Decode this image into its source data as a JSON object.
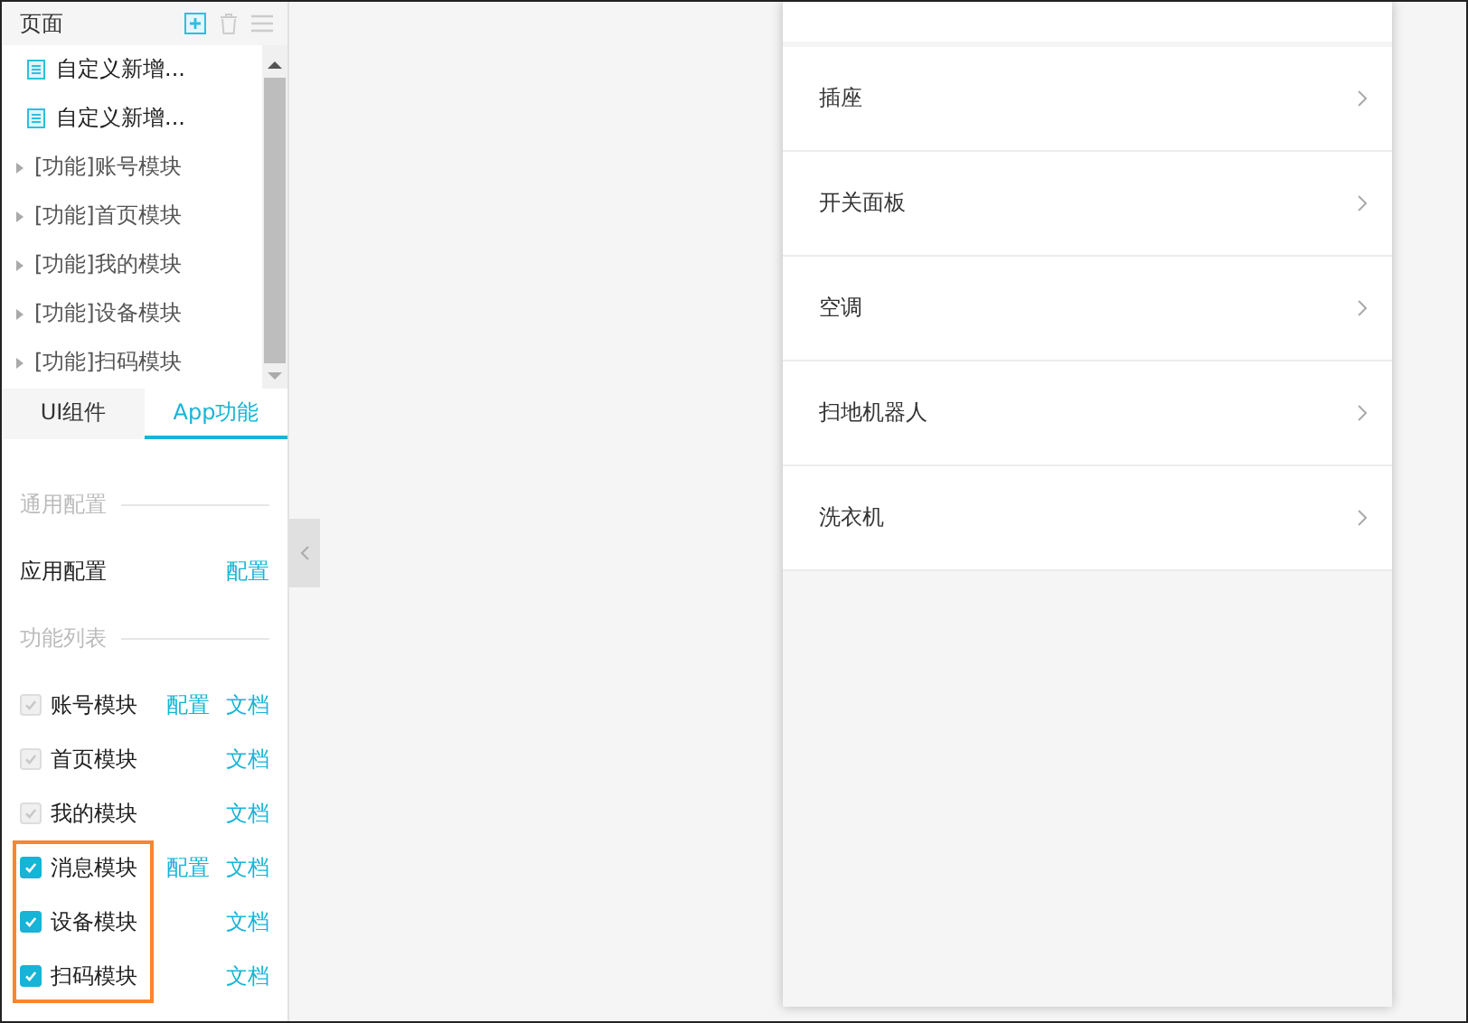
{
  "pages_panel": {
    "title": "页面",
    "items": [
      {
        "kind": "page",
        "label": "自定义新增..."
      },
      {
        "kind": "page",
        "label": "自定义新增..."
      },
      {
        "kind": "group",
        "label": "[功能]账号模块"
      },
      {
        "kind": "group",
        "label": "[功能]首页模块"
      },
      {
        "kind": "group",
        "label": "[功能]我的模块"
      },
      {
        "kind": "group",
        "label": "[功能]设备模块"
      },
      {
        "kind": "group",
        "label": "[功能]扫码模块"
      }
    ]
  },
  "tabs": [
    {
      "label": "UI组件",
      "selected": false
    },
    {
      "label": "App功能",
      "selected": true
    }
  ],
  "general": {
    "title": "通用配置",
    "rows": [
      {
        "label": "应用配置",
        "links": [
          "配置"
        ]
      }
    ]
  },
  "features": {
    "title": "功能列表",
    "modules": [
      {
        "label": "账号模块",
        "checked": true,
        "disabled": true,
        "highlighted": false,
        "links": [
          "配置",
          "文档"
        ]
      },
      {
        "label": "首页模块",
        "checked": true,
        "disabled": true,
        "highlighted": false,
        "links": [
          "文档"
        ]
      },
      {
        "label": "我的模块",
        "checked": true,
        "disabled": true,
        "highlighted": false,
        "links": [
          "文档"
        ]
      },
      {
        "label": "消息模块",
        "checked": true,
        "disabled": false,
        "highlighted": true,
        "links": [
          "配置",
          "文档"
        ]
      },
      {
        "label": "设备模块",
        "checked": true,
        "disabled": false,
        "highlighted": true,
        "links": [
          "文档"
        ]
      },
      {
        "label": "扫码模块",
        "checked": true,
        "disabled": false,
        "highlighted": true,
        "links": [
          "文档"
        ]
      }
    ]
  },
  "phone": {
    "list": [
      "插座",
      "开关面板",
      "空调",
      "扫地机器人",
      "洗衣机"
    ]
  }
}
